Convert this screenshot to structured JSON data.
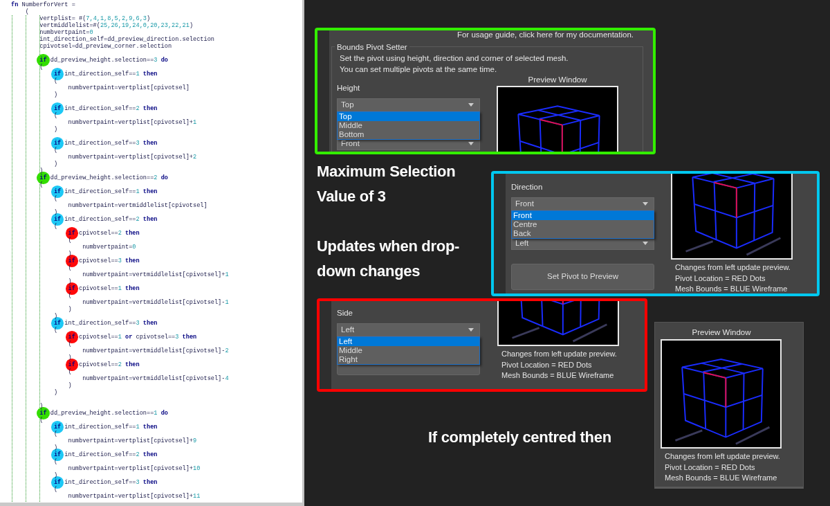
{
  "code_editor": {
    "lines": [
      {
        "kind": "code",
        "segments": [
          {
            "text": "fn",
            "kind": "keyword"
          },
          {
            "text": " NumberforVert =",
            "kind": "plain"
          }
        ]
      },
      {
        "kind": "code",
        "segments": [
          {
            "text": "    (",
            "kind": "plain"
          }
        ]
      },
      {
        "kind": "code",
        "segments": [
          {
            "text": "        vertplist= #(",
            "kind": "plain"
          },
          {
            "text": "7,4,1,8,5,2,9,6,3",
            "kind": "number"
          },
          {
            "text": ")",
            "kind": "plain"
          }
        ]
      },
      {
        "kind": "code",
        "segments": [
          {
            "text": "        vertmiddlelist=#(",
            "kind": "plain"
          },
          {
            "text": "25,26,19,24,0,20,23,22,21",
            "kind": "number"
          },
          {
            "text": ")",
            "kind": "plain"
          }
        ]
      },
      {
        "kind": "code",
        "segments": [
          {
            "text": "        numbvertpaint=",
            "kind": "plain"
          },
          {
            "text": "0",
            "kind": "number"
          }
        ]
      },
      {
        "kind": "code",
        "segments": [
          {
            "text": "        int_direction_self=dd_preview_direction.selection",
            "kind": "plain"
          }
        ]
      },
      {
        "kind": "code",
        "segments": [
          {
            "text": "        cpivotsel=dd_preview_corner.selection",
            "kind": "plain"
          }
        ]
      },
      {
        "kind": "blank"
      },
      {
        "kind": "code",
        "segments": [
          {
            "text": "        if",
            "kind": "keyword",
            "color": "#33dd00"
          },
          {
            "text": " dd_preview_height.selection==",
            "kind": "plain"
          },
          {
            "text": "3",
            "kind": "number"
          },
          {
            "text": " do",
            "kind": "keyword"
          }
        ]
      },
      {
        "kind": "code",
        "segments": [
          {
            "text": "        (",
            "kind": "plain"
          }
        ]
      },
      {
        "kind": "code",
        "segments": [
          {
            "text": "            if",
            "kind": "keyword",
            "color": "#1ec8f5"
          },
          {
            "text": " int_direction_self==",
            "kind": "plain"
          },
          {
            "text": "1",
            "kind": "number"
          },
          {
            "text": " then",
            "kind": "keyword"
          }
        ]
      },
      {
        "kind": "code",
        "segments": [
          {
            "text": "            (",
            "kind": "plain"
          }
        ]
      },
      {
        "kind": "code",
        "segments": [
          {
            "text": "                numbvertpaint=vertplist[cpivotsel]",
            "kind": "plain"
          }
        ]
      },
      {
        "kind": "code",
        "segments": [
          {
            "text": "            )",
            "kind": "plain"
          }
        ]
      },
      {
        "kind": "blank"
      },
      {
        "kind": "code",
        "segments": [
          {
            "text": "            if",
            "kind": "keyword",
            "color": "#1ec8f5"
          },
          {
            "text": " int_direction_self==",
            "kind": "plain"
          },
          {
            "text": "2",
            "kind": "number"
          },
          {
            "text": " then",
            "kind": "keyword"
          }
        ]
      },
      {
        "kind": "code",
        "segments": [
          {
            "text": "            (",
            "kind": "plain"
          }
        ]
      },
      {
        "kind": "code",
        "segments": [
          {
            "text": "                numbvertpaint=vertplist[cpivotsel]+",
            "kind": "plain"
          },
          {
            "text": "1",
            "kind": "number"
          }
        ]
      },
      {
        "kind": "code",
        "segments": [
          {
            "text": "            )",
            "kind": "plain"
          }
        ]
      },
      {
        "kind": "blank"
      },
      {
        "kind": "code",
        "segments": [
          {
            "text": "            if",
            "kind": "keyword",
            "color": "#1ec8f5"
          },
          {
            "text": " int_direction_self==",
            "kind": "plain"
          },
          {
            "text": "3",
            "kind": "number"
          },
          {
            "text": " then",
            "kind": "keyword"
          }
        ]
      },
      {
        "kind": "code",
        "segments": [
          {
            "text": "            (",
            "kind": "plain"
          }
        ]
      },
      {
        "kind": "code",
        "segments": [
          {
            "text": "                numbvertpaint=vertplist[cpivotsel]+",
            "kind": "plain"
          },
          {
            "text": "2",
            "kind": "number"
          }
        ]
      },
      {
        "kind": "code",
        "segments": [
          {
            "text": "            )",
            "kind": "plain"
          }
        ]
      },
      {
        "kind": "code",
        "segments": [
          {
            "text": "        )",
            "kind": "plain"
          }
        ]
      },
      {
        "kind": "code",
        "segments": [
          {
            "text": "        if",
            "kind": "keyword",
            "color": "#33dd00"
          },
          {
            "text": " dd_preview_height.selection==",
            "kind": "plain"
          },
          {
            "text": "2",
            "kind": "number"
          },
          {
            "text": " do",
            "kind": "keyword"
          }
        ]
      },
      {
        "kind": "code",
        "segments": [
          {
            "text": "        (",
            "kind": "plain"
          }
        ]
      },
      {
        "kind": "code",
        "segments": [
          {
            "text": "            if",
            "kind": "keyword",
            "color": "#1ec8f5"
          },
          {
            "text": " int_direction_self==",
            "kind": "plain"
          },
          {
            "text": "1",
            "kind": "number"
          },
          {
            "text": " then",
            "kind": "keyword"
          }
        ]
      },
      {
        "kind": "code",
        "segments": [
          {
            "text": "            (",
            "kind": "plain"
          }
        ]
      },
      {
        "kind": "code",
        "segments": [
          {
            "text": "                numbvertpaint=vertmiddlelist[cpivotsel]",
            "kind": "plain"
          }
        ]
      },
      {
        "kind": "code",
        "segments": [
          {
            "text": "            )",
            "kind": "plain"
          }
        ]
      },
      {
        "kind": "code",
        "segments": [
          {
            "text": "            if",
            "kind": "keyword",
            "color": "#1ec8f5"
          },
          {
            "text": " int_direction_self==",
            "kind": "plain"
          },
          {
            "text": "2",
            "kind": "number"
          },
          {
            "text": " then",
            "kind": "keyword"
          }
        ]
      },
      {
        "kind": "code",
        "segments": [
          {
            "text": "            (",
            "kind": "plain"
          }
        ]
      },
      {
        "kind": "code",
        "segments": [
          {
            "text": "                if",
            "kind": "keyword",
            "color": "#ff0a0a"
          },
          {
            "text": " cpivotsel==",
            "kind": "plain"
          },
          {
            "text": "2",
            "kind": "number"
          },
          {
            "text": " then",
            "kind": "keyword"
          }
        ]
      },
      {
        "kind": "code",
        "segments": [
          {
            "text": "                (",
            "kind": "plain"
          }
        ]
      },
      {
        "kind": "code",
        "segments": [
          {
            "text": "                    numbvertpaint=",
            "kind": "plain"
          },
          {
            "text": "0",
            "kind": "number"
          }
        ]
      },
      {
        "kind": "code",
        "segments": [
          {
            "text": "                )",
            "kind": "plain"
          }
        ]
      },
      {
        "kind": "code",
        "segments": [
          {
            "text": "                if",
            "kind": "keyword",
            "color": "#ff0a0a"
          },
          {
            "text": " cpivotsel==",
            "kind": "plain"
          },
          {
            "text": "3",
            "kind": "number"
          },
          {
            "text": " then",
            "kind": "keyword"
          }
        ]
      },
      {
        "kind": "code",
        "segments": [
          {
            "text": "                (",
            "kind": "plain"
          }
        ]
      },
      {
        "kind": "code",
        "segments": [
          {
            "text": "                    numbvertpaint=vertmiddlelist[cpivotsel]+",
            "kind": "plain"
          },
          {
            "text": "1",
            "kind": "number"
          }
        ]
      },
      {
        "kind": "code",
        "segments": [
          {
            "text": "                )",
            "kind": "plain"
          }
        ]
      },
      {
        "kind": "code",
        "segments": [
          {
            "text": "                if",
            "kind": "keyword",
            "color": "#ff0a0a"
          },
          {
            "text": " cpivotsel==",
            "kind": "plain"
          },
          {
            "text": "1",
            "kind": "number"
          },
          {
            "text": " then",
            "kind": "keyword"
          }
        ]
      },
      {
        "kind": "code",
        "segments": [
          {
            "text": "                (",
            "kind": "plain"
          }
        ]
      },
      {
        "kind": "code",
        "segments": [
          {
            "text": "                    numbvertpaint=vertmiddlelist[cpivotsel]-",
            "kind": "plain"
          },
          {
            "text": "1",
            "kind": "number"
          }
        ]
      },
      {
        "kind": "code",
        "segments": [
          {
            "text": "                )",
            "kind": "plain"
          }
        ]
      },
      {
        "kind": "code",
        "segments": [
          {
            "text": "            )",
            "kind": "plain"
          }
        ]
      },
      {
        "kind": "code",
        "segments": [
          {
            "text": "            if",
            "kind": "keyword",
            "color": "#1ec8f5"
          },
          {
            "text": " int_direction_self==",
            "kind": "plain"
          },
          {
            "text": "3",
            "kind": "number"
          },
          {
            "text": " then",
            "kind": "keyword"
          }
        ]
      },
      {
        "kind": "code",
        "segments": [
          {
            "text": "            (",
            "kind": "plain"
          }
        ]
      },
      {
        "kind": "code",
        "segments": [
          {
            "text": "                if",
            "kind": "keyword",
            "color": "#ff0a0a"
          },
          {
            "text": " cpivotsel==",
            "kind": "plain"
          },
          {
            "text": "1",
            "kind": "number"
          },
          {
            "text": " or",
            "kind": "keyword"
          },
          {
            "text": " cpivotsel==",
            "kind": "plain"
          },
          {
            "text": "3",
            "kind": "number"
          },
          {
            "text": " then",
            "kind": "keyword"
          }
        ]
      },
      {
        "kind": "code",
        "segments": [
          {
            "text": "                (",
            "kind": "plain"
          }
        ]
      },
      {
        "kind": "code",
        "segments": [
          {
            "text": "                    numbvertpaint=vertmiddlelist[cpivotsel]-",
            "kind": "plain"
          },
          {
            "text": "2",
            "kind": "number"
          }
        ]
      },
      {
        "kind": "code",
        "segments": [
          {
            "text": "                )",
            "kind": "plain"
          }
        ]
      },
      {
        "kind": "code",
        "segments": [
          {
            "text": "                if",
            "kind": "keyword",
            "color": "#ff0a0a"
          },
          {
            "text": " cpivotsel==",
            "kind": "plain"
          },
          {
            "text": "2",
            "kind": "number"
          },
          {
            "text": " then",
            "kind": "keyword"
          }
        ]
      },
      {
        "kind": "code",
        "segments": [
          {
            "text": "                (",
            "kind": "plain"
          }
        ]
      },
      {
        "kind": "code",
        "segments": [
          {
            "text": "                    numbvertpaint=vertmiddlelist[cpivotsel]-",
            "kind": "plain"
          },
          {
            "text": "4",
            "kind": "number"
          }
        ]
      },
      {
        "kind": "code",
        "segments": [
          {
            "text": "                )",
            "kind": "plain"
          }
        ]
      },
      {
        "kind": "code",
        "segments": [
          {
            "text": "            )",
            "kind": "plain"
          }
        ]
      },
      {
        "kind": "blank"
      },
      {
        "kind": "code",
        "segments": [
          {
            "text": "        )",
            "kind": "plain"
          }
        ]
      },
      {
        "kind": "code",
        "segments": [
          {
            "text": "        if",
            "kind": "keyword",
            "color": "#33dd00"
          },
          {
            "text": " dd_preview_height.selection==",
            "kind": "plain"
          },
          {
            "text": "1",
            "kind": "number"
          },
          {
            "text": " do",
            "kind": "keyword"
          }
        ]
      },
      {
        "kind": "code",
        "segments": [
          {
            "text": "        (",
            "kind": "plain"
          }
        ]
      },
      {
        "kind": "code",
        "segments": [
          {
            "text": "            if",
            "kind": "keyword",
            "color": "#1ec8f5"
          },
          {
            "text": " int_direction_self==",
            "kind": "plain"
          },
          {
            "text": "1",
            "kind": "number"
          },
          {
            "text": " then",
            "kind": "keyword"
          }
        ]
      },
      {
        "kind": "code",
        "segments": [
          {
            "text": "            (",
            "kind": "plain"
          }
        ]
      },
      {
        "kind": "code",
        "segments": [
          {
            "text": "                numbvertpaint=vertplist[cpivotsel]+",
            "kind": "plain"
          },
          {
            "text": "9",
            "kind": "number"
          }
        ]
      },
      {
        "kind": "code",
        "segments": [
          {
            "text": "            )",
            "kind": "plain"
          }
        ]
      },
      {
        "kind": "code",
        "segments": [
          {
            "text": "            if",
            "kind": "keyword",
            "color": "#1ec8f5"
          },
          {
            "text": " int_direction_self==",
            "kind": "plain"
          },
          {
            "text": "2",
            "kind": "number"
          },
          {
            "text": " then",
            "kind": "keyword"
          }
        ]
      },
      {
        "kind": "code",
        "segments": [
          {
            "text": "            (",
            "kind": "plain"
          }
        ]
      },
      {
        "kind": "code",
        "segments": [
          {
            "text": "                numbvertpaint=vertplist[cpivotsel]+",
            "kind": "plain"
          },
          {
            "text": "10",
            "kind": "number"
          }
        ]
      },
      {
        "kind": "code",
        "segments": [
          {
            "text": "            )",
            "kind": "plain"
          }
        ]
      },
      {
        "kind": "code",
        "segments": [
          {
            "text": "            if",
            "kind": "keyword",
            "color": "#1ec8f5"
          },
          {
            "text": " int_direction_self==",
            "kind": "plain"
          },
          {
            "text": "3",
            "kind": "number"
          },
          {
            "text": " then",
            "kind": "keyword"
          }
        ]
      },
      {
        "kind": "code",
        "segments": [
          {
            "text": "            (",
            "kind": "plain"
          }
        ]
      },
      {
        "kind": "code",
        "segments": [
          {
            "text": "                numbvertpaint=vertplist[cpivotsel]+",
            "kind": "plain"
          },
          {
            "text": "11",
            "kind": "number"
          }
        ]
      }
    ]
  },
  "panels": [
    {
      "color": "#33ee00",
      "link": "For usage guide, click here for my documentation.",
      "group_title": "Bounds Pivot Setter",
      "description": [
        "Set the pivot using height, direction and corner of selected mesh.",
        "You can set multiple pivots at the same time."
      ],
      "dropdown": {
        "label": "Height",
        "value": "Top",
        "options": [
          {
            "label": "Top",
            "selected": true
          },
          {
            "label": "Middle",
            "selected": false
          },
          {
            "label": "Bottom",
            "selected": false
          }
        ]
      },
      "next_dropdown": {
        "value": "Front"
      },
      "preview": {
        "title": "Preview Window"
      }
    },
    {
      "color": "#00c8f0",
      "dropdown": {
        "label": "Direction",
        "value": "Front",
        "options": [
          {
            "label": "Front",
            "selected": true
          },
          {
            "label": "Centre",
            "selected": false
          },
          {
            "label": "Back",
            "selected": false
          }
        ]
      },
      "next_dropdown": {
        "value": "Left"
      },
      "button": "Set Pivot to Preview",
      "preview": {
        "caption": [
          "Changes from left update preview.",
          "Pivot Location = RED Dots",
          "Mesh Bounds = BLUE Wireframe"
        ]
      }
    },
    {
      "color": "#ff0000",
      "dropdown": {
        "label": "Side",
        "value": "Left",
        "options": [
          {
            "label": "Left",
            "selected": true
          },
          {
            "label": "Middle",
            "selected": false
          },
          {
            "label": "Right",
            "selected": false
          }
        ]
      },
      "hidden_button": true,
      "preview": {
        "caption": [
          "Changes from left update preview.",
          "Pivot Location = RED Dots",
          "Mesh Bounds = BLUE Wireframe"
        ]
      }
    }
  ],
  "preview_window": {
    "title": "Preview Window",
    "caption": [
      "Changes from left update preview.",
      "Pivot Location = RED Dots",
      "Mesh Bounds = BLUE Wireframe"
    ]
  },
  "notes": [
    {
      "lines": [
        "Maximum Selection",
        "Value of 3"
      ]
    },
    {
      "lines": [
        "Updates when drop-",
        "down changes"
      ]
    },
    {
      "lines": [
        "If completely centred then"
      ]
    }
  ]
}
